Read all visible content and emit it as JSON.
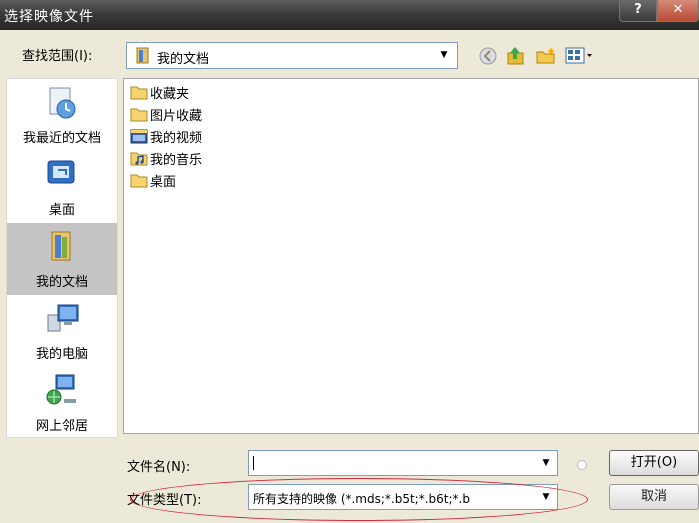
{
  "window": {
    "title": "选择映像文件",
    "help_label": "?",
    "close_label": "✕"
  },
  "lookin": {
    "label": "查找范围(I):",
    "value": "我的文档"
  },
  "places": [
    {
      "label": "我最近的文档",
      "icon": "recent-documents-icon"
    },
    {
      "label": "桌面",
      "icon": "desktop-icon"
    },
    {
      "label": "我的文档",
      "icon": "my-documents-icon"
    },
    {
      "label": "我的电脑",
      "icon": "my-computer-icon"
    },
    {
      "label": "网上邻居",
      "icon": "network-places-icon"
    }
  ],
  "files": [
    {
      "name": "收藏夹",
      "icon": "folder-icon"
    },
    {
      "name": "图片收藏",
      "icon": "folder-icon"
    },
    {
      "name": "我的视频",
      "icon": "video-folder-icon"
    },
    {
      "name": "我的音乐",
      "icon": "music-folder-icon"
    },
    {
      "name": "桌面",
      "icon": "folder-icon"
    }
  ],
  "filename": {
    "label": "文件名(N):",
    "value": ""
  },
  "filetype": {
    "label": "文件类型(T):",
    "value": "所有支持的映像 (*.mds;*.b5t;*.b6t;*.b"
  },
  "buttons": {
    "open": "打开(O)",
    "cancel": "取消"
  },
  "colors": {
    "annotation": "#d3293a",
    "selection": "#c4c4c4"
  }
}
